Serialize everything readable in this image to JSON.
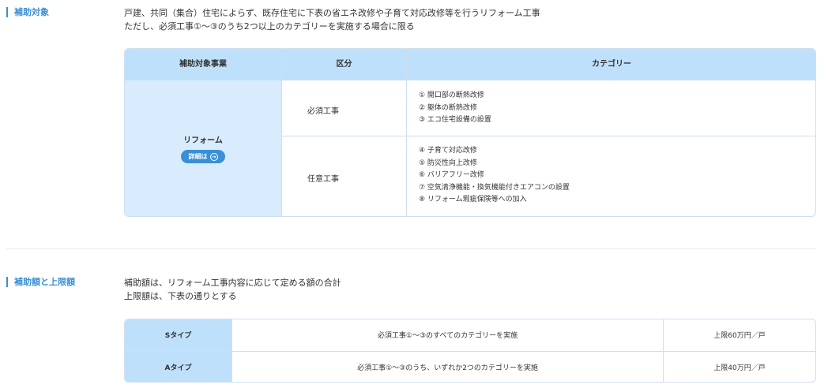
{
  "section1": {
    "label": "補助対象",
    "desc_line1": "戸建、共同（集合）住宅によらず、既存住宅に下表の省エネ改修や子育て対応改修等を行うリフォーム工事",
    "desc_line2": "ただし、必須工事①〜③のうち2つ以上のカテゴリーを実施する場合に限る"
  },
  "table1": {
    "headers": [
      "補助対象事業",
      "区分",
      "カテゴリー"
    ],
    "project": "リフォーム",
    "detail_button": "詳細は",
    "rows": [
      {
        "kubun": "必須工事",
        "categories": [
          "① 開口部の断熱改修",
          "② 躯体の断熱改修",
          "③ エコ住宅設備の設置"
        ]
      },
      {
        "kubun": "任意工事",
        "categories": [
          "④ 子育て対応改修",
          "⑤ 防災性向上改修",
          "⑥ バリアフリー改修",
          "⑦ 空気清浄機能・換気機能付きエアコンの設置",
          "⑧ リフォーム瑕疵保険等への加入"
        ]
      }
    ]
  },
  "section2": {
    "label": "補助額と上限額",
    "desc_line1": "補助額は、リフォーム工事内容に応じて定める額の合計",
    "desc_line2": "上限額は、下表の通りとする"
  },
  "table2": {
    "rows": [
      {
        "type": "Sタイプ",
        "condition": "必須工事①〜③のすべてのカテゴリーを実施",
        "limit": "上限60万円／戸"
      },
      {
        "type": "Aタイプ",
        "condition": "必須工事①〜③のうち、いずれか2つのカテゴリーを実施",
        "limit": "上限40万円／戸"
      }
    ]
  },
  "colors": {
    "accent": "#3a8fd6",
    "header_bg": "#bfe0fb",
    "project_bg": "#d8ecfd",
    "border": "#cfdfee"
  }
}
